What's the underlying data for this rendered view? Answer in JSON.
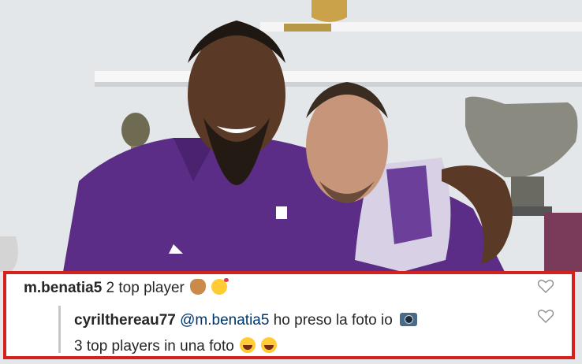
{
  "comments": [
    {
      "username": "m.benatia5",
      "text": "2 top player",
      "emojis": [
        "ok-hand-icon",
        "kiss-face-icon"
      ]
    },
    {
      "username": "cyrilthereau77",
      "mention": "@m.benatia5",
      "text": "ho preso la foto io",
      "emoji": "camera-icon",
      "text_line2": "3 top players in una foto",
      "emojis_line2": [
        "laughing-face-icon",
        "laughing-face-icon"
      ]
    }
  ],
  "colors": {
    "highlight_border": "#d6201e",
    "jersey_purple": "#5b2d86",
    "text": "#262626"
  }
}
